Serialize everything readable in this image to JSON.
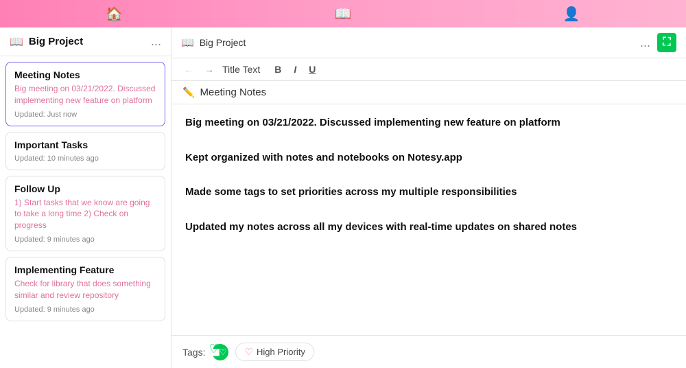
{
  "topNav": {
    "homeIcon": "🏠",
    "bookIcon": "📖",
    "userIcon": "👤"
  },
  "sidebar": {
    "title": "Big Project",
    "moreLabel": "...",
    "notes": [
      {
        "id": "meeting-notes",
        "title": "Meeting Notes",
        "preview": "Big meeting on 03/21/2022. Discussed implementing new feature on platform",
        "updated": "Updated: Just now",
        "active": true
      },
      {
        "id": "important-tasks",
        "title": "Important Tasks",
        "preview": "",
        "updated": "Updated: 10 minutes ago",
        "active": false
      },
      {
        "id": "follow-up",
        "title": "Follow Up",
        "preview": "1) Start tasks that we know are going to take a long time 2) Check on progress",
        "updated": "Updated: 9 minutes ago",
        "active": false
      },
      {
        "id": "implementing-feature",
        "title": "Implementing Feature",
        "preview": "Check for library that does something similar and review repository",
        "updated": "Updated: 9 minutes ago",
        "active": false
      }
    ]
  },
  "panel": {
    "bookIcon": "📖",
    "title": "Big Project",
    "moreLabel": "...",
    "expandLabel": "⛶"
  },
  "toolbar": {
    "backArrow": "←",
    "forwardArrow": "→",
    "titleText": "Title Text",
    "boldLabel": "B",
    "italicLabel": "I",
    "underlineLabel": "U"
  },
  "noteContent": {
    "editIcon": "✏",
    "headerTitle": "Meeting Notes",
    "paragraphs": [
      "Big meeting on 03/21/2022.  Discussed implementing new feature on platform",
      "Kept organized with notes and notebooks on Notesy.app",
      "Made some tags to set priorities across my multiple responsibilities",
      "Updated my notes across all my devices with real-time updates on shared notes"
    ]
  },
  "tagsFooter": {
    "label": "Tags:",
    "addIcon": "+",
    "tagName": "High Priority",
    "tagHeart": "♡"
  }
}
